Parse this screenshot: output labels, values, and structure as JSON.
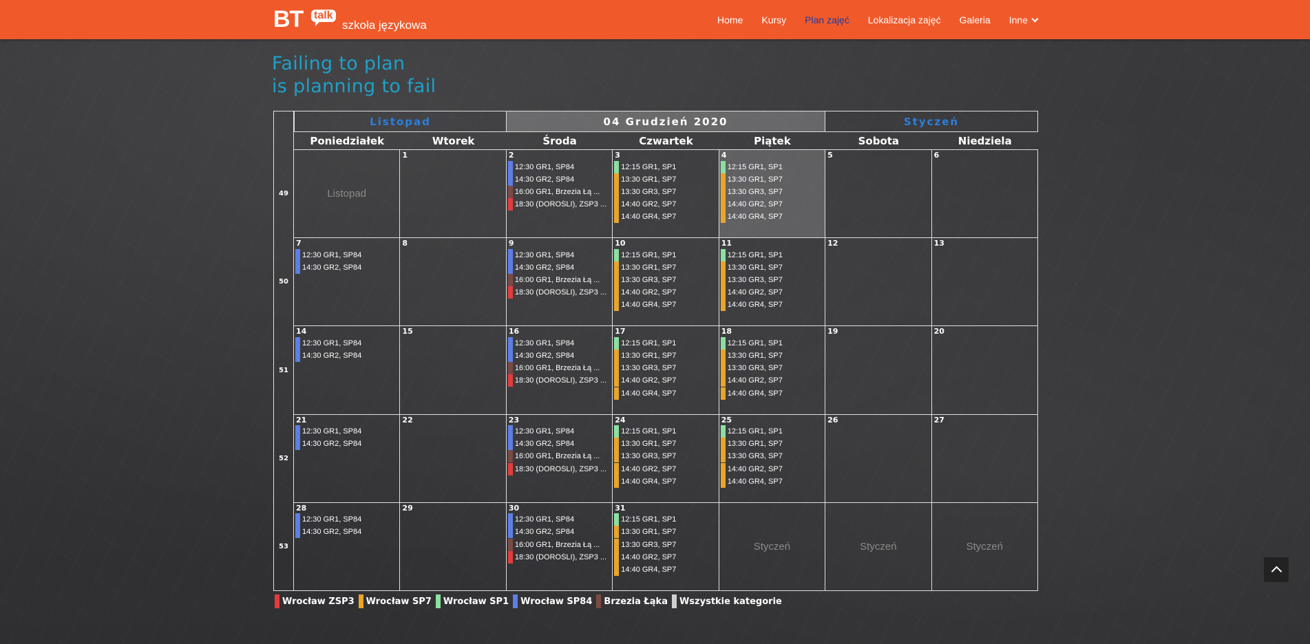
{
  "nav": {
    "logo_bt": "BT",
    "logo_talk": "talk",
    "logo_sub": "szkoła językowa",
    "links": [
      "Home",
      "Kursy",
      "Plan zajęć",
      "Lokalizacja zajęć",
      "Galeria",
      "Inne"
    ],
    "active_index": 2
  },
  "motto": [
    "Failing to plan",
    "is planning to fail"
  ],
  "calendar": {
    "prev_month": "Listopad",
    "current": "04 Grudzień 2020",
    "next_month": "Styczeń",
    "weekdays": [
      "Poniedziałek",
      "Wtorek",
      "Środa",
      "Czwartek",
      "Piątek",
      "Sobota",
      "Niedziela"
    ],
    "weeks": [
      {
        "num": "49",
        "days": [
          {
            "ghost": "Listopad"
          },
          {
            "d": "1"
          },
          {
            "d": "2",
            "ev": "wed"
          },
          {
            "d": "3",
            "ev": "thu"
          },
          {
            "d": "4",
            "ev": "fri",
            "hl": true
          },
          {
            "d": "5"
          },
          {
            "d": "6"
          }
        ]
      },
      {
        "num": "50",
        "days": [
          {
            "d": "7",
            "ev": "mon"
          },
          {
            "d": "8"
          },
          {
            "d": "9",
            "ev": "wed"
          },
          {
            "d": "10",
            "ev": "thu"
          },
          {
            "d": "11",
            "ev": "fri"
          },
          {
            "d": "12"
          },
          {
            "d": "13"
          }
        ]
      },
      {
        "num": "51",
        "days": [
          {
            "d": "14",
            "ev": "mon"
          },
          {
            "d": "15"
          },
          {
            "d": "16",
            "ev": "wed"
          },
          {
            "d": "17",
            "ev": "thu"
          },
          {
            "d": "18",
            "ev": "fri"
          },
          {
            "d": "19"
          },
          {
            "d": "20"
          }
        ]
      },
      {
        "num": "52",
        "days": [
          {
            "d": "21",
            "ev": "mon"
          },
          {
            "d": "22"
          },
          {
            "d": "23",
            "ev": "wed"
          },
          {
            "d": "24",
            "ev": "thu"
          },
          {
            "d": "25",
            "ev": "fri"
          },
          {
            "d": "26"
          },
          {
            "d": "27"
          }
        ]
      },
      {
        "num": "53",
        "days": [
          {
            "d": "28",
            "ev": "mon"
          },
          {
            "d": "29"
          },
          {
            "d": "30",
            "ev": "wed"
          },
          {
            "d": "31",
            "ev": "thu"
          },
          {
            "ghost": "Styczeń"
          },
          {
            "ghost": "Styczeń"
          },
          {
            "ghost": "Styczeń"
          }
        ]
      }
    ],
    "event_sets": {
      "mon": [
        {
          "t": "12:30 GR1, SP84",
          "c": "#5b7fe6"
        },
        {
          "t": "14:30 GR2, SP84",
          "c": "#5b7fe6"
        }
      ],
      "wed": [
        {
          "t": "12:30 GR1, SP84",
          "c": "#5b7fe6"
        },
        {
          "t": "14:30 GR2, SP84",
          "c": "#5b7fe6"
        },
        {
          "t": "16:00 GR1, Brzezia Łą ...",
          "c": "#7a4a46"
        },
        {
          "t": "18:30 (DOROŚLI), ZSP3 ...",
          "c": "#e23c3c"
        }
      ],
      "thu": [
        {
          "t": "12:15 GR1, SP1",
          "c": "#8be0a0"
        },
        {
          "t": "13:30 GR1, SP7",
          "c": "#e8a52a"
        },
        {
          "t": "13:30 GR3, SP7",
          "c": "#e8a52a"
        },
        {
          "t": "14:40 GR2, SP7",
          "c": "#e8a52a"
        },
        {
          "t": "14:40 GR4, SP7",
          "c": "#e8a52a"
        }
      ],
      "fri": [
        {
          "t": "12:15 GR1, SP1",
          "c": "#8be0a0"
        },
        {
          "t": "13:30 GR1, SP7",
          "c": "#e8a52a"
        },
        {
          "t": "13:30 GR3, SP7",
          "c": "#e8a52a"
        },
        {
          "t": "14:40 GR2, SP7",
          "c": "#e8a52a"
        },
        {
          "t": "14:40 GR4, SP7",
          "c": "#e8a52a"
        }
      ]
    }
  },
  "legend": [
    {
      "label": "Wrocław ZSP3",
      "color": "#e23c3c"
    },
    {
      "label": "Wrocław SP7",
      "color": "#e8a52a"
    },
    {
      "label": "Wrocław SP1",
      "color": "#8be0a0"
    },
    {
      "label": "Wrocław SP84",
      "color": "#5b7fe6"
    },
    {
      "label": "Brzezia Łąka",
      "color": "#7a4a46"
    },
    {
      "label": "Wszystkie kategorie",
      "color": "#cfcfcf"
    }
  ]
}
